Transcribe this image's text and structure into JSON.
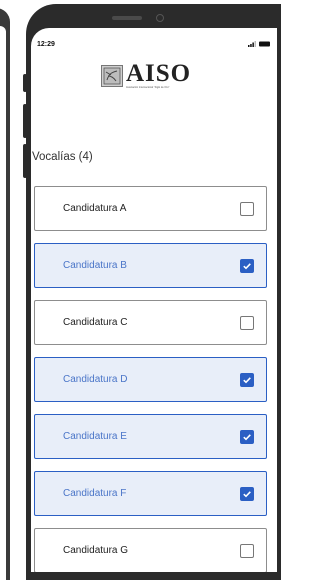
{
  "status_bar": {
    "time": "12:29"
  },
  "logo": {
    "title": "AISO",
    "subtitle": "Asociación Internacional “Siglo de Oro”"
  },
  "section": {
    "title": "Vocalías (4)"
  },
  "items": [
    {
      "label": "Candidatura A",
      "checked": false
    },
    {
      "label": "Candidatura B",
      "checked": true
    },
    {
      "label": "Candidatura C",
      "checked": false
    },
    {
      "label": "Candidatura D",
      "checked": true
    },
    {
      "label": "Candidatura E",
      "checked": true
    },
    {
      "label": "Candidatura F",
      "checked": true
    },
    {
      "label": "Candidatura G",
      "checked": false
    }
  ],
  "colors": {
    "selected_border": "#2b5fc4",
    "selected_background": "#e8eef9",
    "selected_text": "#4a75c8",
    "frame": "#2b2b2b"
  },
  "icons": {
    "signal": "signal-icon",
    "battery": "battery-icon",
    "check": "checkmark-icon",
    "logo": "aiso-emblem-icon"
  }
}
